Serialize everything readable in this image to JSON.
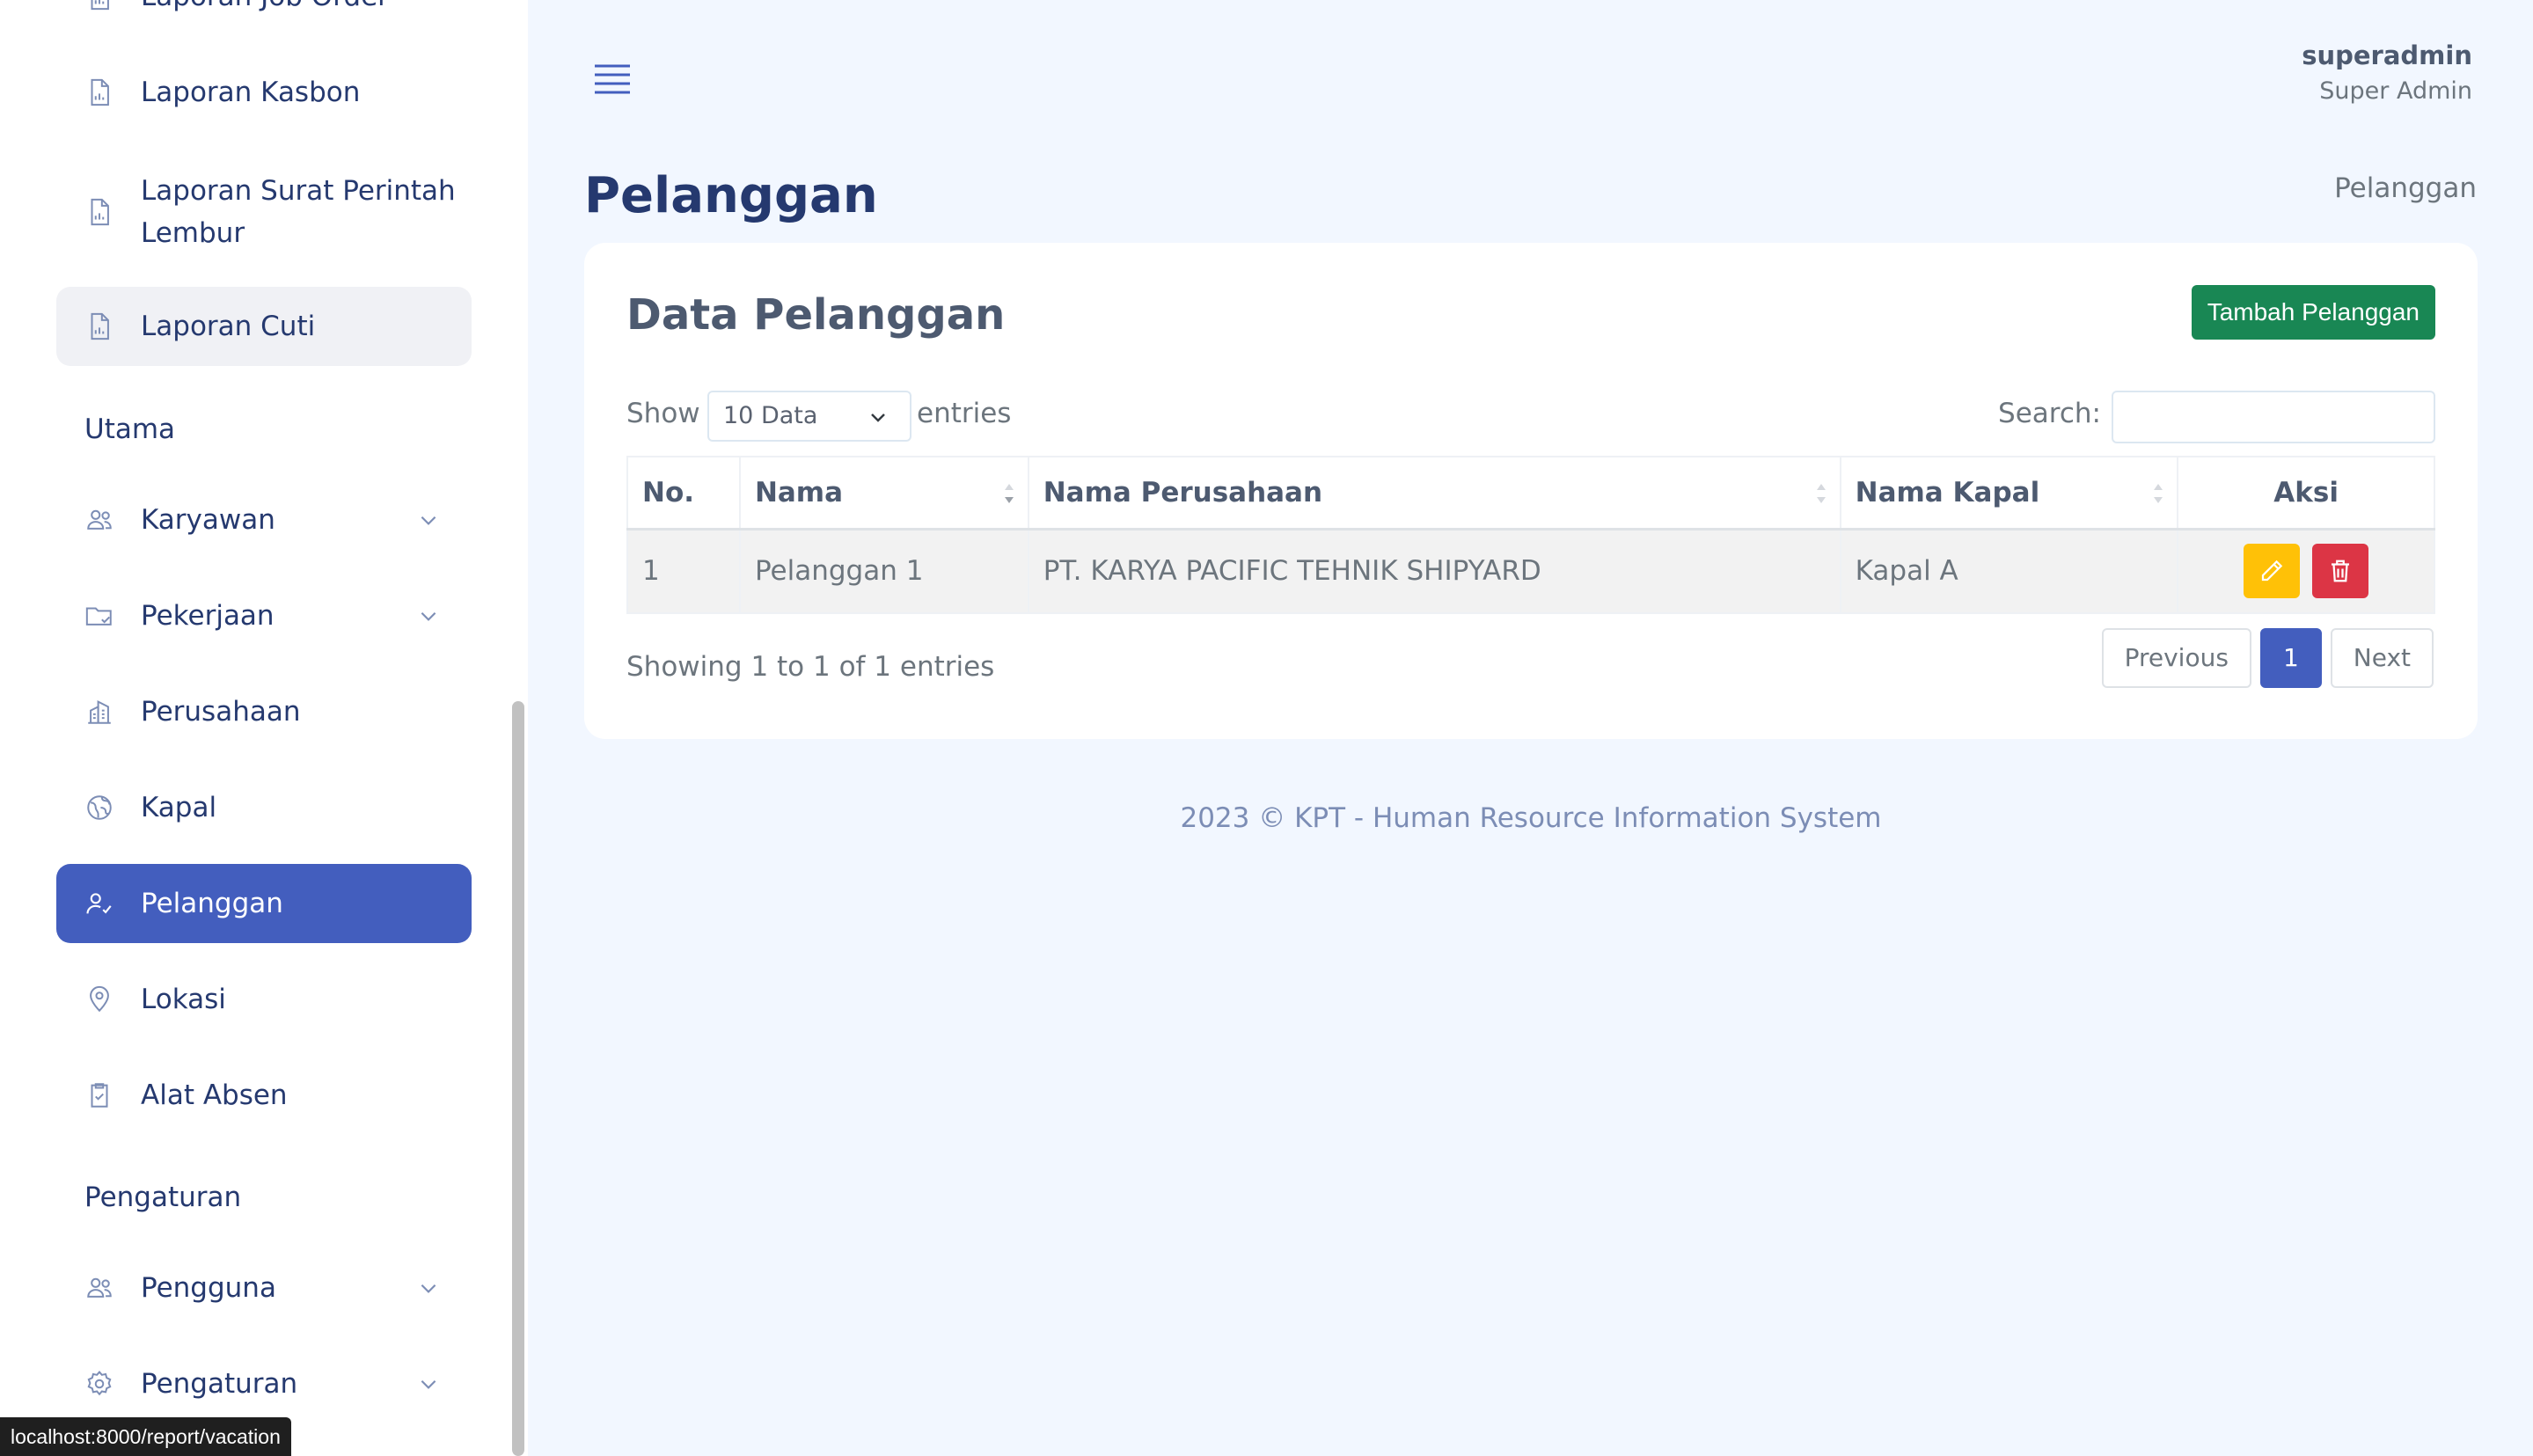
{
  "sidebar": {
    "items": [
      {
        "label": "Laporan Job Order"
      },
      {
        "label": "Laporan Kasbon"
      },
      {
        "label": "Laporan Surat Perintah Lembur"
      },
      {
        "label": "Laporan Cuti"
      },
      {
        "label": "Karyawan"
      },
      {
        "label": "Pekerjaan"
      },
      {
        "label": "Perusahaan"
      },
      {
        "label": "Kapal"
      },
      {
        "label": "Pelanggan"
      },
      {
        "label": "Lokasi"
      },
      {
        "label": "Alat Absen"
      },
      {
        "label": "Pengguna"
      },
      {
        "label": "Pengaturan"
      }
    ],
    "sections": {
      "main": "Utama",
      "settings": "Pengaturan"
    }
  },
  "header": {
    "user_name": "superadmin",
    "user_role": "Super Admin"
  },
  "page": {
    "title": "Pelanggan",
    "breadcrumb": "Pelanggan"
  },
  "card": {
    "title": "Data Pelanggan",
    "add_button": "Tambah Pelanggan",
    "show_label": "Show",
    "length_value": "10 Data",
    "entries_label": "entries",
    "search_label": "Search:",
    "search_value": ""
  },
  "table": {
    "columns": [
      "No.",
      "Nama",
      "Nama Perusahaan",
      "Nama Kapal",
      "Aksi"
    ],
    "rows": [
      {
        "no": "1",
        "nama": "Pelanggan 1",
        "perusahaan": "PT. KARYA PACIFIC TEHNIK SHIPYARD",
        "kapal": "Kapal A"
      }
    ]
  },
  "info": "Showing 1 to 1 of 1 entries",
  "pagination": {
    "previous": "Previous",
    "current": "1",
    "next": "Next"
  },
  "footer": "2023 © KPT - Human Resource Information System",
  "status_url": "localhost:8000/report/vacation",
  "colors": {
    "primary": "#435ebe",
    "success": "#198754",
    "warning": "#ffc107",
    "danger": "#dc3545",
    "background": "#f2f7ff"
  }
}
